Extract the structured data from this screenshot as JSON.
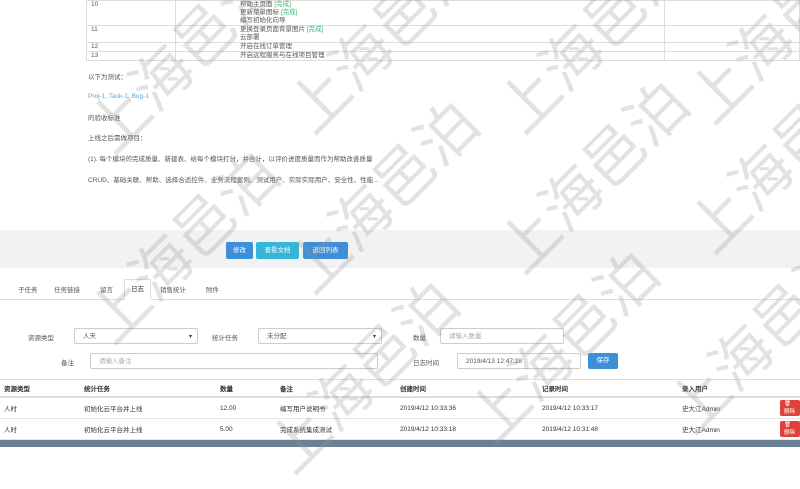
{
  "task_rows": [
    {
      "num": "10",
      "lines": [
        {
          "text": "帮助主页面",
          "tag": "[完成]"
        },
        {
          "text": "更新菜单图标",
          "tag": "[完成]"
        },
        {
          "text": "编写初始化向导",
          "tag": ""
        }
      ]
    },
    {
      "num": "11",
      "lines": [
        {
          "text": "更换登录页面背景图片",
          "tag": "[完成]"
        },
        {
          "text": "云部署",
          "tag": ""
        }
      ]
    },
    {
      "num": "12",
      "lines": [
        {
          "text": "开启在线订单管理",
          "tag": ""
        }
      ]
    },
    {
      "num": "13",
      "lines": [
        {
          "text": "开启远程服务与在线项目管理",
          "tag": ""
        }
      ]
    }
  ],
  "paragraphs": {
    "test_intro": "以下为测试：",
    "link": "Proj-1, Task-1, Bug-1",
    "acceptance": "的验收标准",
    "online_note": "上线之后需做项目：",
    "item1": "(1). 每个模块的完成质量、新建表、给每个模块打分，并合计，以评价进度质量而作为帮助改善质量",
    "item2": "CRUD、基础关联、帮助、选择合适控件、业务流程案例、测试用户、实际实际用户、安全性、性能..."
  },
  "toolbar": {
    "edit": "修改",
    "view_doc": "查看文档",
    "back": "返回列表"
  },
  "tabs": [
    "子任务",
    "任务链接",
    "留言",
    "日志",
    "销售统计",
    "附件"
  ],
  "active_tab": "日志",
  "form": {
    "resource_type_label": "资源类型",
    "resource_type_value": "人天",
    "stat_task_label": "统计任务",
    "stat_task_value": "未分配",
    "quantity_label": "数量",
    "quantity_placeholder": "请输入数量",
    "remark_label": "备注",
    "remark_placeholder": "请输入备注",
    "log_time_label": "日志时间",
    "log_time_value": "2019/4/13 12:47:28",
    "save": "保存"
  },
  "table": {
    "headers": [
      "资源类型",
      "统计任务",
      "数量",
      "备注",
      "创建时间",
      "记录时间",
      "录入用户",
      ""
    ],
    "rows": [
      {
        "type": "人时",
        "task": "初始化云平台并上线",
        "qty": "12.00",
        "remark": "编写用户说明书",
        "created": "2019/4/12 10:33:36",
        "recorded": "2019/4/12 10:33:17",
        "user": "史大江Admin",
        "action": "删除"
      },
      {
        "type": "人时",
        "task": "初始化云平台并上线",
        "qty": "5.00",
        "remark": "完成系统集成测试",
        "created": "2019/4/12 10:33:18",
        "recorded": "2019/4/12 10:31:48",
        "user": "史大江Admin",
        "action": "删除"
      }
    ]
  },
  "watermark": "上海邑泊",
  "colors": {
    "primary": "#3d8fd9",
    "info": "#35b6d8",
    "danger": "#e0413a",
    "done_tag": "#3cb371"
  }
}
